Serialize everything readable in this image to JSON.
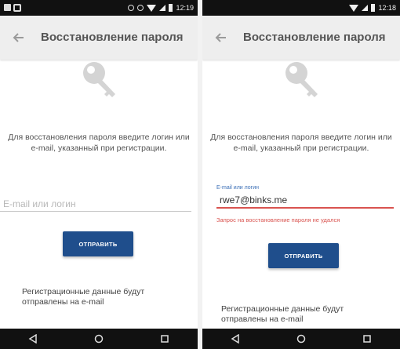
{
  "left": {
    "status_bar": {
      "time": "12:19"
    },
    "app_bar": {
      "title": "Восстановление пароля"
    },
    "instruction": "Для восстановления пароля введите логин или e-mail, указанный при регистрации.",
    "input": {
      "placeholder": "E-mail или логин",
      "value": ""
    },
    "submit_label": "ОТПРАВИТЬ",
    "note": "Регистрационные данные будут отправлены на e-mail"
  },
  "right": {
    "status_bar": {
      "time": "12:18"
    },
    "app_bar": {
      "title": "Восстановление пароля"
    },
    "instruction": "Для восстановления пароля введите логин или e-mail, указанный при регистрации.",
    "input": {
      "label": "E-mail или логин",
      "value": "rwe7@binks.me"
    },
    "error": "Запрос на восстановление пароля не удался",
    "submit_label": "ОТПРАВИТЬ",
    "note": "Регистрационные данные будут отправлены на e-mail"
  },
  "colors": {
    "app_bar_bg": "#eeeeee",
    "button_bg": "#1f4e8c",
    "error": "#d9534f",
    "label_accent": "#3b6fb6"
  },
  "icons": [
    "back-arrow-icon",
    "key-icon",
    "nav-back-icon",
    "nav-home-icon",
    "nav-recents-icon"
  ]
}
